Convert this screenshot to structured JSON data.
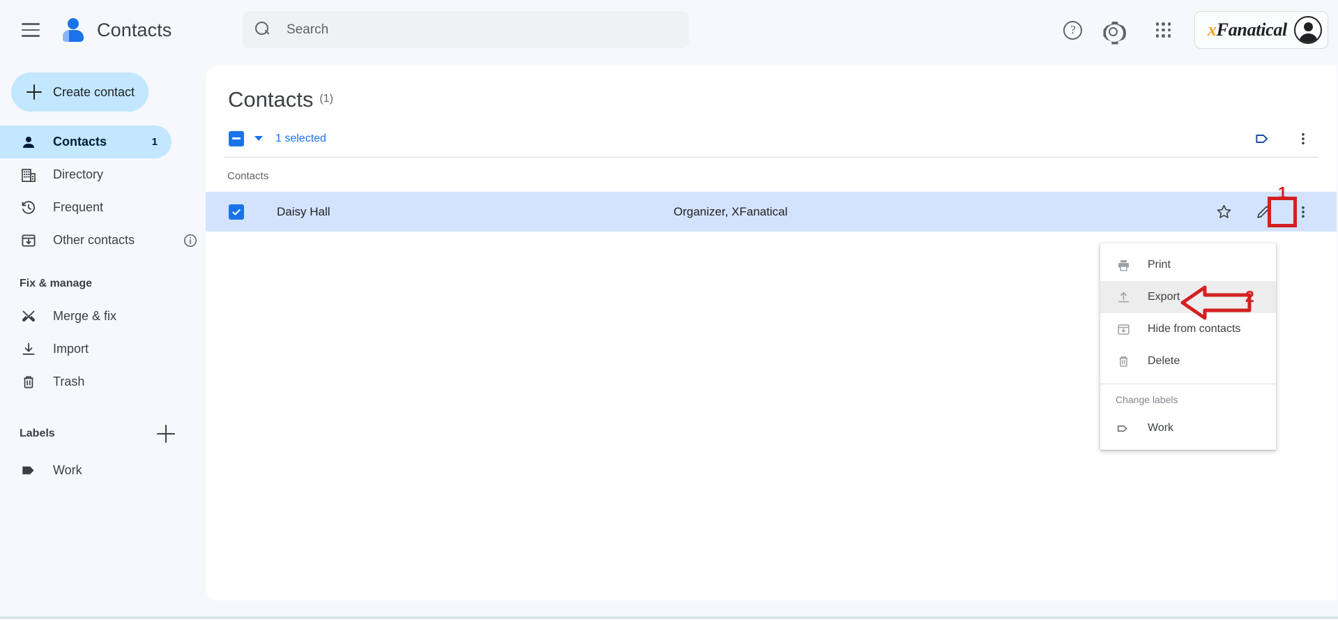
{
  "app": {
    "title": "Contacts",
    "logo_icon": "contacts-person-icon"
  },
  "topbar": {
    "menu_icon": "hamburger-menu-icon",
    "help_icon": "help-circle-icon",
    "settings_icon": "gear-icon",
    "apps_icon": "apps-grid-icon",
    "account": {
      "name_x": "x",
      "name_rest": "Fanatical",
      "avatar_icon": "avatar-icon"
    }
  },
  "search": {
    "placeholder": "Search",
    "value": "",
    "icon": "search-icon"
  },
  "sidebar": {
    "create_button": {
      "label": "Create contact",
      "icon": "plus-icon"
    },
    "items": [
      {
        "label": "Contacts",
        "icon": "person-icon",
        "badge": "1",
        "active": true
      },
      {
        "label": "Directory",
        "icon": "building-icon",
        "badge": "",
        "active": false
      },
      {
        "label": "Frequent",
        "icon": "history-clock-icon",
        "badge": "",
        "active": false
      },
      {
        "label": "Other contacts",
        "icon": "inbox-download-icon",
        "badge": "",
        "active": false,
        "info_icon": "info-circle-icon"
      }
    ],
    "fix_manage_title": "Fix & manage",
    "fix_manage_items": [
      {
        "label": "Merge & fix",
        "icon": "merge-tools-icon"
      },
      {
        "label": "Import",
        "icon": "import-download-icon"
      },
      {
        "label": "Trash",
        "icon": "trash-icon"
      }
    ],
    "labels_title": "Labels",
    "add_label_icon": "plus-icon",
    "labels": [
      {
        "label": "Work",
        "icon": "label-tag-filled-icon"
      }
    ]
  },
  "main": {
    "page_title": "Contacts",
    "page_count": "(1)",
    "selection": {
      "checkbox_state": "indeterminate",
      "caret_icon": "chevron-down-icon",
      "text": "1 selected",
      "label_icon": "label-tag-icon",
      "more_icon": "more-vert-icon"
    },
    "list_header": "Contacts",
    "rows": [
      {
        "name": "Daisy Hall",
        "organization": "Organizer, XFanatical",
        "checked": true,
        "star_icon": "star-outline-icon",
        "edit_icon": "pencil-icon",
        "more_icon": "more-vert-icon"
      }
    ]
  },
  "context_menu": {
    "items": [
      {
        "label": "Print",
        "icon": "printer-icon",
        "highlighted": false
      },
      {
        "label": "Export",
        "icon": "export-upload-icon",
        "highlighted": true
      },
      {
        "label": "Hide from contacts",
        "icon": "hide-inbox-icon",
        "highlighted": false
      },
      {
        "label": "Delete",
        "icon": "trash-icon",
        "highlighted": false
      }
    ],
    "section_title": "Change labels",
    "labels": [
      {
        "label": "Work",
        "icon": "label-tag-icon"
      }
    ]
  },
  "annotations": {
    "step1": "1",
    "step2": "2",
    "color": "#d32020"
  },
  "colors": {
    "accent_blue": "#1a73e8",
    "light_blue": "#c2e7ff",
    "row_selected": "#d3e3fd",
    "background": "#f6f8fc",
    "panel": "#ffffff",
    "brand_orange": "#f5a623"
  }
}
